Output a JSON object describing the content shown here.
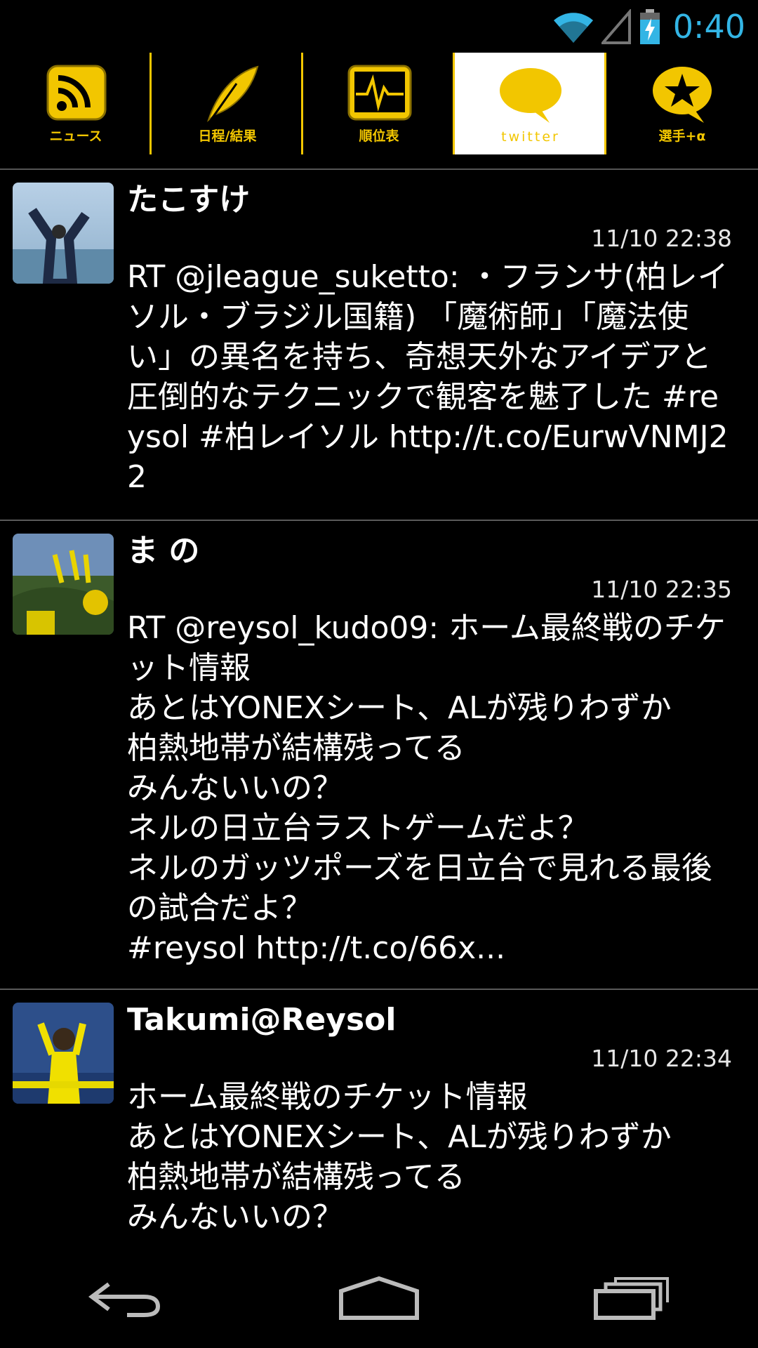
{
  "status_bar": {
    "time": "0:40",
    "icons": [
      "wifi-icon",
      "cell-signal-icon",
      "battery-charging-icon"
    ],
    "clock_color": "#33b5e5"
  },
  "tabs": [
    {
      "label": "ニュース",
      "icon": "rss-icon",
      "active": false
    },
    {
      "label": "日程/結果",
      "icon": "quill-icon",
      "active": false
    },
    {
      "label": "順位表",
      "icon": "pulse-chart-icon",
      "active": false
    },
    {
      "label": "twitter",
      "icon": "speech-bubble-icon",
      "active": true
    },
    {
      "label": "選手+α",
      "icon": "star-bubble-icon",
      "active": false
    }
  ],
  "accent_color": "#f2c600",
  "tweets": [
    {
      "name": "たこすけ",
      "time": "11/10 22:38",
      "text": "RT @jleague_suketto: ・フランサ(柏レイソル・ブラジル国籍) 「魔術師」「魔法使い」の異名を持ち、奇想天外なアイデアと圧倒的なテクニックで観客を魅了した #reysol #柏レイソル http://t.co/EurwVNMJ22"
    },
    {
      "name": "ま の",
      "time": "11/10 22:35",
      "text": "RT @reysol_kudo09: ホーム最終戦のチケット情報\nあとはYONEXシート、ALが残りわずか\n柏熱地帯が結構残ってる\nみんないいの？\nネルの日立台ラストゲームだよ？\nネルのガッツポーズを日立台で見れる最後の試合だよ？\n#reysol http://t.co/66x..."
    },
    {
      "name": "Takumi@Reysol",
      "time": "11/10 22:34",
      "text": "ホーム最終戦のチケット情報\nあとはYONEXシート、ALが残りわずか\n柏熱地帯が結構残ってる\nみんないいの？"
    }
  ],
  "nav_bar": {
    "icons": [
      "back-icon",
      "home-icon",
      "recent-apps-icon"
    ]
  }
}
